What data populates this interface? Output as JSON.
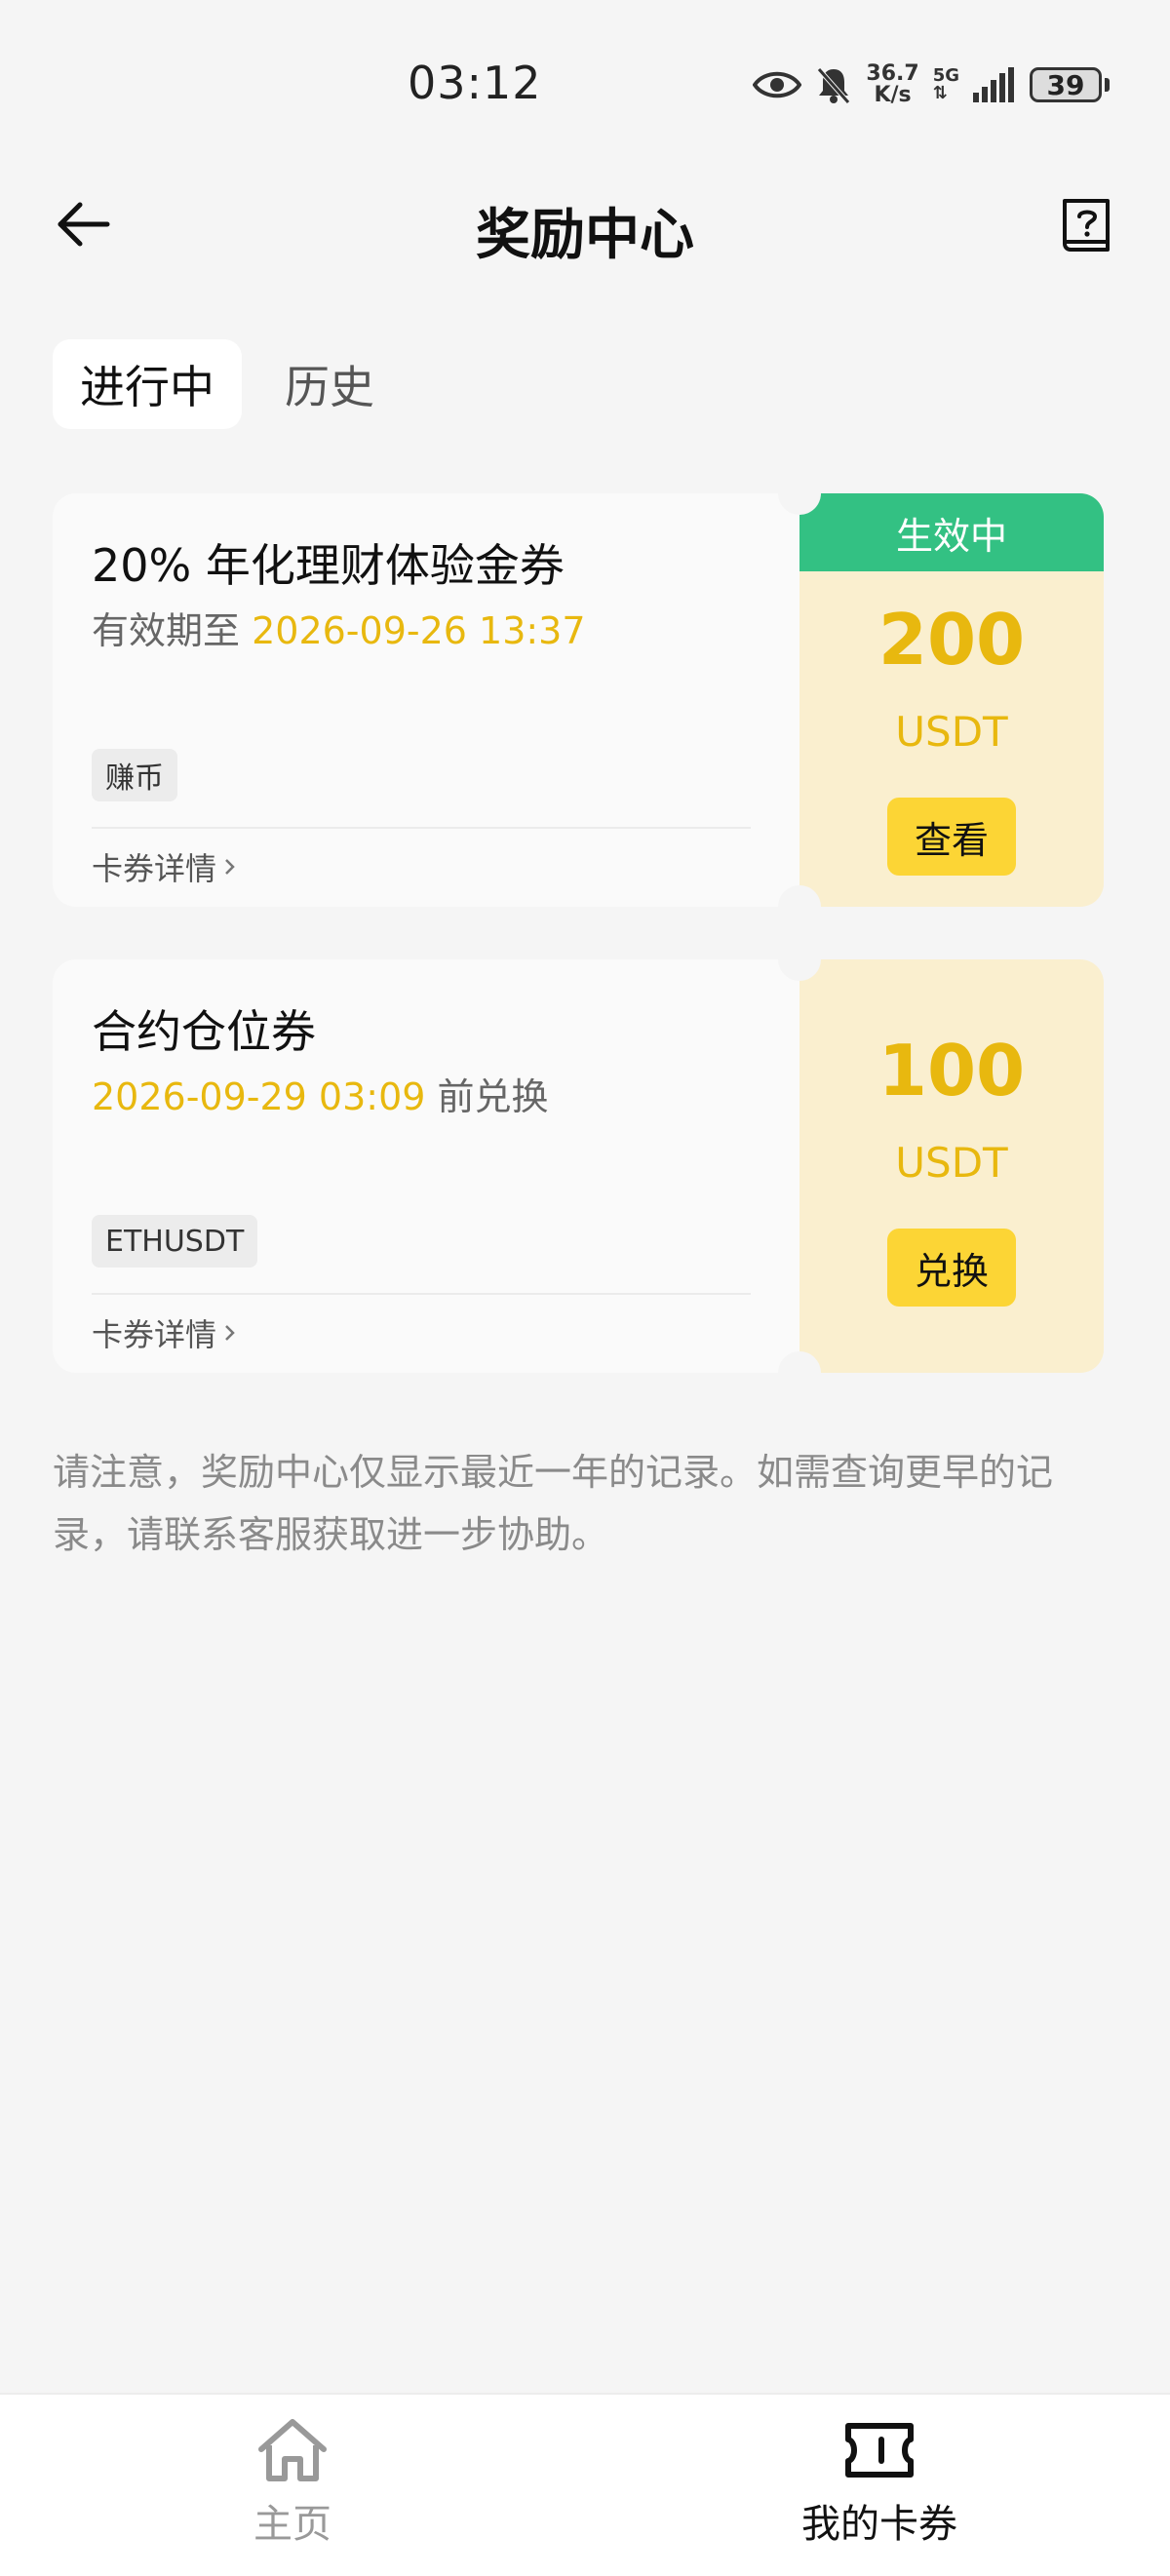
{
  "status_bar": {
    "time": "03:12",
    "net_speed_value": "36.7",
    "net_speed_unit": "K/s",
    "network": "5G",
    "battery": "39"
  },
  "header": {
    "title": "奖励中心"
  },
  "tabs": [
    {
      "label": "进行中",
      "active": true
    },
    {
      "label": "历史",
      "active": false
    }
  ],
  "cards": [
    {
      "title": "20% 年化理财体验金券",
      "sub_prefix": "有效期至 ",
      "sub_date": "2026-09-26 13:37",
      "sub_suffix": "",
      "tag": "赚币",
      "detail_link": "卡券详情",
      "status_badge": "生效中",
      "amount": "200",
      "unit": "USDT",
      "action": "查看"
    },
    {
      "title": "合约仓位券",
      "sub_prefix": "",
      "sub_date": "2026-09-29 03:09",
      "sub_suffix": " 前兑换",
      "tag": "ETHUSDT",
      "detail_link": "卡券详情",
      "status_badge": "",
      "amount": "100",
      "unit": "USDT",
      "action": "兑换"
    }
  ],
  "notice": "请注意，奖励中心仅显示最近一年的记录。如需查询更早的记录，请联系客服获取进一步协助。",
  "bottom_nav": [
    {
      "label": "主页",
      "icon": "home-icon",
      "active": false
    },
    {
      "label": "我的卡券",
      "icon": "ticket-icon",
      "active": true
    }
  ],
  "colors": {
    "accent_gold": "#e8b80f",
    "button_yellow": "#fcd535",
    "status_green": "#33c183",
    "coupon_bg": "#faefcf"
  }
}
